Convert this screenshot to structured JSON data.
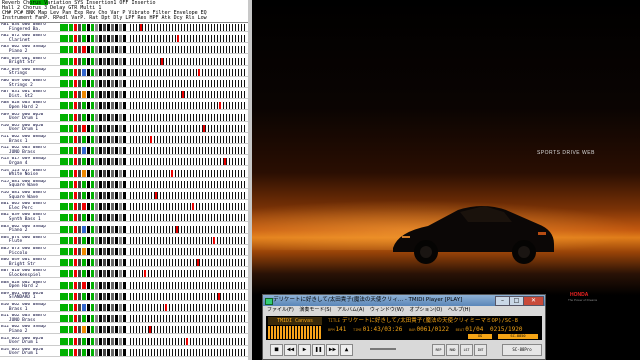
{
  "monitor": {
    "header_line1": "Reverb  Chorus   Variation  SYS  Insertion1  OFF  Insertio",
    "header_line2": "Hall 2  Chorus 3  Delay           GTR Multi 1",
    "header_line3": "CH#  PC# BNK Map  Lev  Pan  Exp  Rev  Cho  Var  P  Vibrato  Filter  Envelope  EQ",
    "header_line4": "    Instrument      FanP. RPedl VarP. Rat Dpt Dly LPF Res HPF Atk Dcy Rls Low",
    "rows": [
      {
        "id": "A01",
        "pc": "034",
        "bnk": "000",
        "map": "08Bro",
        "name": "Fingered Ba."
      },
      {
        "id": "A02",
        "pc": "072",
        "bnk": "000",
        "map": "08Bro",
        "name": "Clarinet"
      },
      {
        "id": "A03",
        "pc": "002",
        "bnk": "000",
        "map": "SSmap",
        "name": "Piano 2"
      },
      {
        "id": "A04",
        "pc": "049",
        "bnk": "001",
        "map": "08Bro",
        "name": "Bright Str"
      },
      {
        "id": "A05",
        "pc": "049",
        "bnk": "000",
        "map": "08map",
        "name": "Strings"
      },
      {
        "id": "A06",
        "pc": "049",
        "bnk": "000",
        "map": "08Bro",
        "name": "Strings 2"
      },
      {
        "id": "A07",
        "pc": "031",
        "bnk": "001",
        "map": "08Bro",
        "name": "Dist. Gt2"
      },
      {
        "id": "A08",
        "pc": "028",
        "bnk": "003",
        "map": "08Bro",
        "name": "Open Hard 2"
      },
      {
        "id": "A09",
        "pc": "065",
        "bnk": "000",
        "map": "0050",
        "name": "User Drum 1"
      },
      {
        "id": "A10",
        "pc": "065",
        "bnk": "000",
        "map": "0050",
        "name": "User Drum 1"
      },
      {
        "id": "A11",
        "pc": "062",
        "bnk": "000",
        "map": "08map",
        "name": "Brass 1"
      },
      {
        "id": "A12",
        "pc": "062",
        "bnk": "003",
        "map": "08Bro",
        "name": "JUNO Brass"
      },
      {
        "id": "A13",
        "pc": "017",
        "bnk": "009",
        "map": "08map",
        "name": "Organ 4"
      },
      {
        "id": "A14",
        "pc": "123",
        "bnk": "017",
        "map": "08Bro",
        "name": "White Noise"
      },
      {
        "id": "A15",
        "pc": "081",
        "bnk": "000",
        "map": "08map",
        "name": "Square Wave"
      },
      {
        "id": "A16",
        "pc": "081",
        "bnk": "000",
        "map": "08Bro",
        "name": "Square Wave"
      },
      {
        "id": "B01",
        "pc": "005",
        "bnk": "000",
        "map": "08Bro",
        "name": "Elec Perc"
      },
      {
        "id": "B02",
        "pc": "039",
        "bnk": "000",
        "map": "08Bro",
        "name": "Synth Bass 1"
      },
      {
        "id": "B03",
        "pc": "002",
        "bnk": "000",
        "map": "SSmap",
        "name": "Piano 2"
      },
      {
        "id": "B04",
        "pc": "074",
        "bnk": "000",
        "map": "08Bro",
        "name": "Flute"
      },
      {
        "id": "B05",
        "pc": "073",
        "bnk": "000",
        "map": "08Bro",
        "name": "Piccolo"
      },
      {
        "id": "B06",
        "pc": "049",
        "bnk": "001",
        "map": "08Bro",
        "name": "Bright Str"
      },
      {
        "id": "B07",
        "pc": "010",
        "bnk": "000",
        "map": "08Bro",
        "name": "Glockenspiel"
      },
      {
        "id": "B08",
        "pc": "028",
        "bnk": "002",
        "map": "08Bro",
        "name": "Open Hard 2"
      },
      {
        "id": "B09",
        "pc": "001",
        "bnk": "000",
        "map": "0050",
        "name": "STANDARD 1"
      },
      {
        "id": "B10",
        "pc": "062",
        "bnk": "000",
        "map": "08map",
        "name": "Brass 1"
      },
      {
        "id": "B11",
        "pc": "062",
        "bnk": "003",
        "map": "08Bro",
        "name": "JUNO Brass"
      },
      {
        "id": "B12",
        "pc": "002",
        "bnk": "000",
        "map": "SSmap",
        "name": "Piano 2"
      },
      {
        "id": "B13",
        "pc": "065",
        "bnk": "000",
        "map": "0050",
        "name": "User Drum 1"
      },
      {
        "id": "B14",
        "pc": "065",
        "bnk": "000",
        "map": "0050",
        "name": "User Drum 1"
      }
    ]
  },
  "wallpaper": {
    "tagline": "SPORTS DRIVE WEB",
    "brand": "HONDA",
    "brand_sub": "The Power of Dreams"
  },
  "player": {
    "window_title": "デリケートに好きして/太田貴子(魔法の天使クリィ... - TMIDI Player [PLAY]",
    "menu": [
      "ファイル(F)",
      "演奏モード(S)",
      "アルバム(A)",
      "ウィンドウ(W)",
      "オプション(O)",
      "ヘルプ(H)"
    ],
    "logo": "TMIDI Canvas",
    "title_label": "TITLE",
    "title_text": "デリケートに好きして/太田貴子(魔法の天使クリィミーマミOP)/SC-8",
    "bpm_label": "BPM",
    "bpm": "141",
    "time_label": "TIME",
    "time": "01:43/03:26",
    "bar_label": "BAR",
    "bar": "0061/0122",
    "beat_label": "BEAT",
    "beat": "01/04",
    "tick": "0215/1920",
    "sub_pill_1": "XG",
    "sub_pill_2": "SC-8850",
    "controls": {
      "stop": "■",
      "prev": "◀◀",
      "play": "▶",
      "pause": "❚❚",
      "next": "▶▶",
      "eject": "▲"
    },
    "modes": [
      "REP",
      "RND",
      "LST",
      "INT"
    ],
    "device": "SC-88Pro",
    "buttons": {
      "minimize": "–",
      "maximize": "□",
      "close": "✕"
    }
  },
  "colors": {
    "monitor_bg": "#ffffff",
    "lcd_bg": "#000000",
    "lcd_fg": "#f5a516",
    "titlebar": "#6f98c8",
    "note_active": "#e00000",
    "level_green": "#00b000"
  }
}
